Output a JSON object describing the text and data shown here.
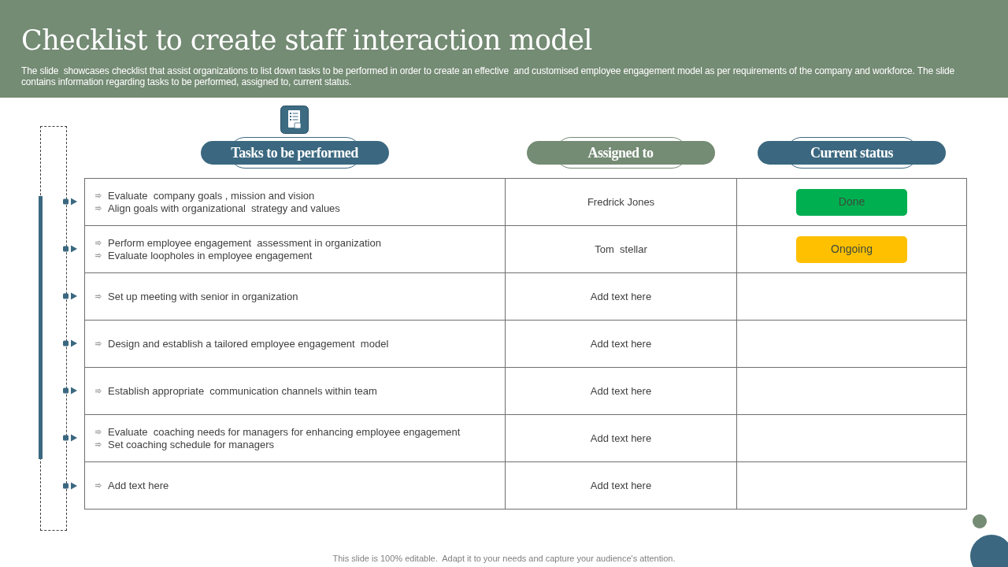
{
  "header": {
    "title": "Checklist to create staff interaction model",
    "description": "The slide  showcases checklist that assist organizations to list down tasks to be performed in order to create an effective  and customised employee engagement model as per requirements of the company and workforce. The slide contains information regarding tasks to be performed, assigned to, current status."
  },
  "columns": [
    {
      "label": "Tasks to be performed",
      "color": "#3b6880"
    },
    {
      "label": "Assigned to",
      "color": "#748b74"
    },
    {
      "label": "Current status",
      "color": "#3b6880"
    }
  ],
  "rows": [
    {
      "tasks": [
        "Evaluate  company goals , mission and vision",
        "Align goals with organizational  strategy and values"
      ],
      "assigned": "Fredrick Jones",
      "status": {
        "label": "Done",
        "color": "#00b050"
      }
    },
    {
      "tasks": [
        "Perform employee engagement  assessment in organization",
        "Evaluate loopholes in employee engagement"
      ],
      "assigned": "Tom  stellar",
      "status": {
        "label": "Ongoing",
        "color": "#ffc000"
      }
    },
    {
      "tasks": [
        "Set up meeting with senior in organization"
      ],
      "assigned": "Add text here"
    },
    {
      "tasks": [
        "Design and establish a tailored employee engagement  model"
      ],
      "assigned": "Add text here"
    },
    {
      "tasks": [
        "Establish appropriate  communication channels within team"
      ],
      "assigned": "Add text here"
    },
    {
      "tasks": [
        "Evaluate  coaching needs for managers for enhancing employee engagement",
        "Set coaching schedule for managers"
      ],
      "assigned": "Add text here"
    },
    {
      "tasks": [
        "Add text here"
      ],
      "assigned": "Add text here"
    }
  ],
  "footer": "This slide is 100% editable.  Adapt it to your needs and capture your audience's attention."
}
